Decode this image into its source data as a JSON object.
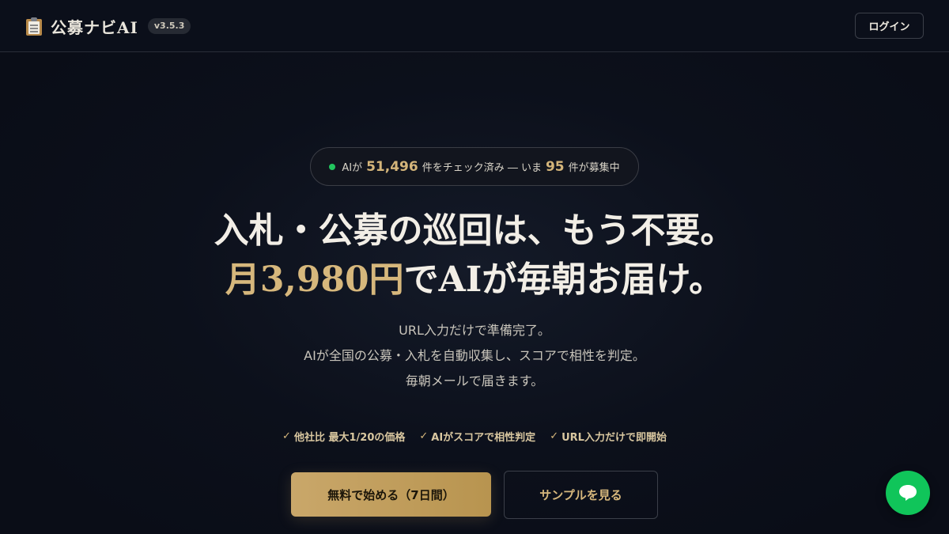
{
  "header": {
    "brand_icon": "clipboard-icon",
    "brand_name": "公募ナビAI",
    "version": "v3.5.3",
    "login_label": "ログイン"
  },
  "stats": {
    "prefix": "AIが",
    "checked_count": "51,496",
    "checked_suffix": "件をチェック済み ― いま",
    "open_count": "95",
    "open_suffix": "件が募集中",
    "dot_color": "#22c55e"
  },
  "hero": {
    "line1": "入札・公募の巡回は、もう不要。",
    "line2_highlight": "月3,980円",
    "line2_rest": "でAIが毎朝お届け。",
    "description": [
      "URL入力だけで準備完了。",
      "AIが全国の公募・入札を自動収集し、スコアで相性を判定。",
      "毎朝メールで届きます。"
    ]
  },
  "features": [
    {
      "check": "✓",
      "label": "他社比 最大1/20の価格"
    },
    {
      "check": "✓",
      "label": "AIがスコアで相性判定"
    },
    {
      "check": "✓",
      "label": "URL入力だけで即開始"
    }
  ],
  "cta": {
    "primary_label": "無料で始める（7日間）",
    "secondary_label": "サンプルを見る"
  },
  "chat": {
    "icon": "chat-bubble-icon",
    "color": "#10c55a"
  },
  "colors": {
    "accent_gold": "#d6b77c",
    "background": "#0b0f1a"
  }
}
